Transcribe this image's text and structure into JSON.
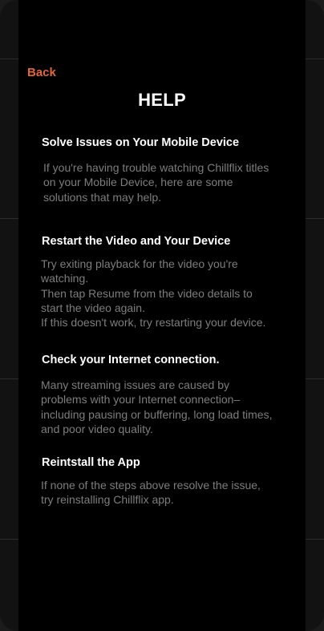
{
  "nav": {
    "back_label": "Back"
  },
  "page": {
    "title": "HELP"
  },
  "sections": [
    {
      "heading": "Solve Issues on Your Mobile Device",
      "text": "If you're having trouble watching Chillflix titles\non your Mobile Device, here are some\nsolutions that may help."
    },
    {
      "heading": "Restart the Video and Your Device",
      "text": "Try exiting playback for the video you're\nwatching.\nThen tap Resume from the video details to\nstart the video again.\nIf this doesn't work, try restarting your device."
    },
    {
      "heading": "Check your Internet connection.",
      "text": "Many streaming issues are caused by\nproblems with your Internet connection–\nincluding pausing or buffering, long load times,\nand poor video quality."
    },
    {
      "heading": "Reintstall the App",
      "text": "If none of the steps above resolve the issue,\ntry reinstalling Chillflix app."
    }
  ]
}
